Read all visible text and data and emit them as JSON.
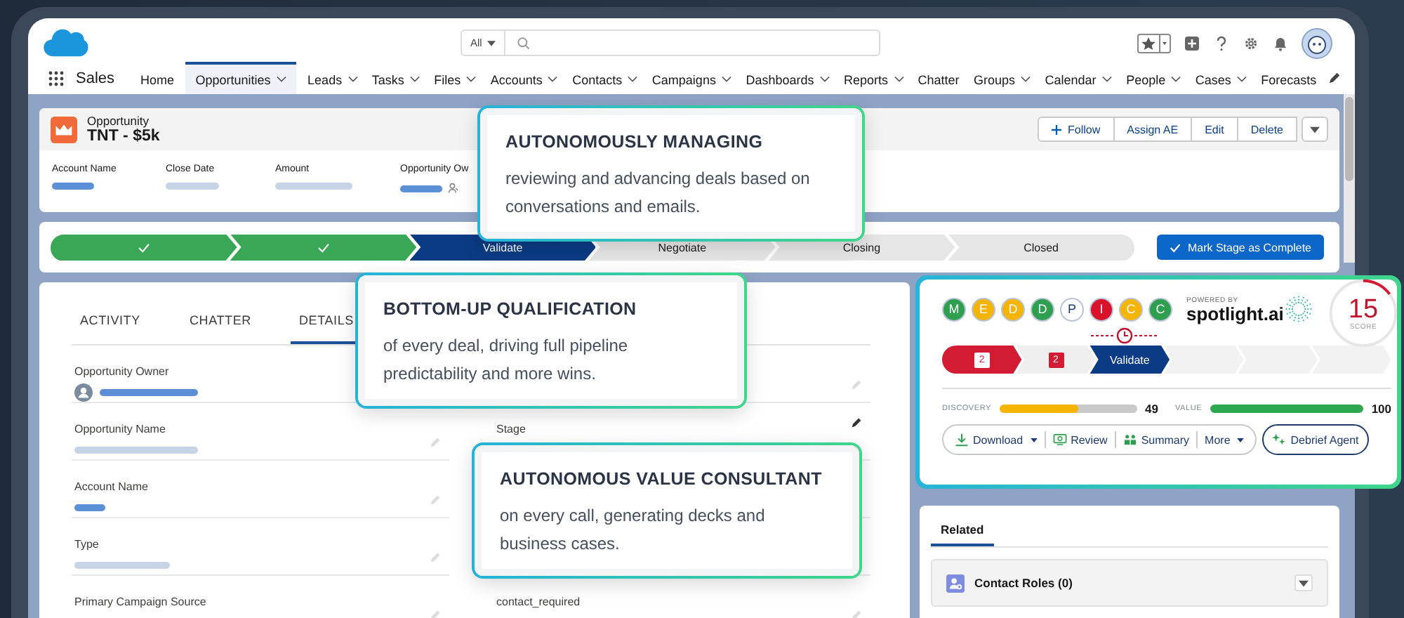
{
  "app": {
    "name": "Sales"
  },
  "search": {
    "scope": "All"
  },
  "nav": [
    {
      "label": "Home",
      "menu": false,
      "selected": false
    },
    {
      "label": "Opportunities",
      "menu": true,
      "selected": true
    },
    {
      "label": "Leads",
      "menu": true,
      "selected": false
    },
    {
      "label": "Tasks",
      "menu": true,
      "selected": false
    },
    {
      "label": "Files",
      "menu": true,
      "selected": false
    },
    {
      "label": "Accounts",
      "menu": true,
      "selected": false
    },
    {
      "label": "Contacts",
      "menu": true,
      "selected": false
    },
    {
      "label": "Campaigns",
      "menu": true,
      "selected": false
    },
    {
      "label": "Dashboards",
      "menu": true,
      "selected": false
    },
    {
      "label": "Reports",
      "menu": true,
      "selected": false
    },
    {
      "label": "Chatter",
      "menu": false,
      "selected": false
    },
    {
      "label": "Groups",
      "menu": true,
      "selected": false
    },
    {
      "label": "Calendar",
      "menu": true,
      "selected": false
    },
    {
      "label": "People",
      "menu": true,
      "selected": false
    },
    {
      "label": "Cases",
      "menu": true,
      "selected": false
    },
    {
      "label": "Forecasts",
      "menu": false,
      "selected": false
    }
  ],
  "record": {
    "type": "Opportunity",
    "title": "TNT - $5k",
    "actions": [
      {
        "label": "Follow",
        "kind": "follow"
      },
      {
        "label": "Assign AE",
        "kind": "plain"
      },
      {
        "label": "Edit",
        "kind": "plain"
      },
      {
        "label": "Delete",
        "kind": "plain"
      }
    ],
    "highlights": [
      {
        "label": "Account Name",
        "kind": "link"
      },
      {
        "label": "Close Date",
        "kind": "text"
      },
      {
        "label": "Amount",
        "kind": "text"
      },
      {
        "label": "Opportunity Ow",
        "kind": "owner"
      }
    ]
  },
  "path": {
    "stages": [
      {
        "kind": "complete"
      },
      {
        "kind": "complete"
      },
      {
        "label": "Validate",
        "kind": "current"
      },
      {
        "label": "Negotiate",
        "kind": "upcoming"
      },
      {
        "label": "Closing",
        "kind": "upcoming"
      },
      {
        "label": "Closed",
        "kind": "upcoming"
      }
    ],
    "button": "Mark Stage as Complete"
  },
  "detail_tabs": [
    {
      "label": "ACTIVITY",
      "selected": false
    },
    {
      "label": "CHATTER",
      "selected": false
    },
    {
      "label": "DETAILS",
      "selected": true
    }
  ],
  "field_rows": [
    {
      "left": {
        "label": "Opportunity Owner",
        "kind": "owner"
      }
    },
    {
      "left": {
        "label": "Opportunity Name",
        "kind": "text"
      },
      "right": {
        "label": "Stage"
      }
    },
    {
      "left": {
        "label": "Account Name",
        "kind": "link"
      }
    },
    {
      "left": {
        "label": "Type",
        "kind": "text"
      }
    },
    {
      "left": {
        "label": "Primary Campaign Source",
        "kind": "none"
      },
      "right": {
        "label": "contact_required"
      }
    }
  ],
  "spotlight": {
    "meddpicc": [
      {
        "letter": "M",
        "color": "#2e9e4f"
      },
      {
        "letter": "E",
        "color": "#f5b400"
      },
      {
        "letter": "D",
        "color": "#f5b400"
      },
      {
        "letter": "D",
        "color": "#2e9e4f"
      },
      {
        "letter": "P",
        "color": "#ffffff"
      },
      {
        "letter": "I",
        "color": "#d9112b"
      },
      {
        "letter": "C",
        "color": "#f5b400"
      },
      {
        "letter": "C",
        "color": "#2e9e4f"
      }
    ],
    "powered_by": "POWERED BY",
    "brand": "spotlight.ai",
    "score": {
      "value": "15",
      "label": "SCORE",
      "level": 0.15
    },
    "stages": [
      {
        "label": "2",
        "kind": "alert-fill"
      },
      {
        "label": "2",
        "kind": "alert-badge"
      },
      {
        "label": "Validate",
        "kind": "current"
      },
      {
        "kind": "upcoming"
      },
      {
        "kind": "upcoming"
      },
      {
        "kind": "upcoming"
      }
    ],
    "meters": [
      {
        "label": "DISCOVERY",
        "level": 0.57,
        "reading": "49",
        "color": "#f5b400"
      },
      {
        "label": "VALUE",
        "level": 1.0,
        "reading": "100",
        "color": "#2ea84f"
      }
    ],
    "actions": [
      {
        "label": "Download",
        "kind": "download",
        "menu": true
      },
      {
        "label": "Review",
        "kind": "review",
        "menu": false
      },
      {
        "label": "Summary",
        "kind": "summary",
        "menu": false
      },
      {
        "label": "More",
        "kind": "more",
        "menu": true
      }
    ],
    "primary": "Debrief Agent"
  },
  "related": {
    "tabs": [
      {
        "label": "Related",
        "selected": true
      }
    ],
    "items": [
      {
        "label": "Contact Roles (0)"
      }
    ]
  },
  "callouts": [
    {
      "title": "AUTONOMOUSLY MANAGING",
      "text": "reviewing and advancing deals based on conversations and emails."
    },
    {
      "title": "BOTTOM-UP QUALIFICATION",
      "text": "of every deal, driving full pipeline predictability and more wins."
    },
    {
      "title": "AUTONOMOUS VALUE CONSULTANT",
      "text": "on every call, generating decks and business cases."
    }
  ]
}
